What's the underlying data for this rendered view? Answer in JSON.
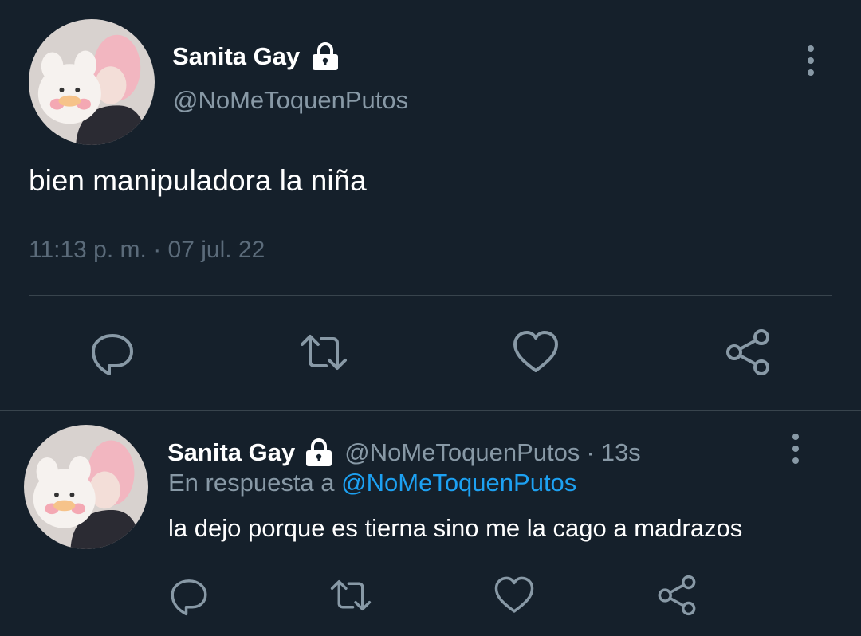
{
  "colors": {
    "background": "#15202b",
    "divider": "#38444d",
    "secondary_text": "#8899a6",
    "meta_text": "#5b6b7a",
    "link": "#1da1f2",
    "icon": "#8899a6"
  },
  "main_tweet": {
    "display_name": "Sanita Gay",
    "handle": "@NoMeToquenPutos",
    "locked_icon": "lock-icon",
    "text": "bien manipuladora la niña",
    "timestamp": "11:13 p. m. · 07 jul. 22",
    "actions": [
      "reply-icon",
      "retweet-icon",
      "like-icon",
      "share-icon"
    ]
  },
  "reply_tweet": {
    "display_name": "Sanita Gay",
    "handle": "@NoMeToquenPutos",
    "dot": "·",
    "time": "13s",
    "reply_prefix": "En respuesta a",
    "reply_mention": "@NoMeToquenPutos",
    "text": "la dejo porque es tierna sino me la cago a madrazos",
    "actions": [
      "reply-icon",
      "retweet-icon",
      "like-icon",
      "share-icon"
    ]
  }
}
